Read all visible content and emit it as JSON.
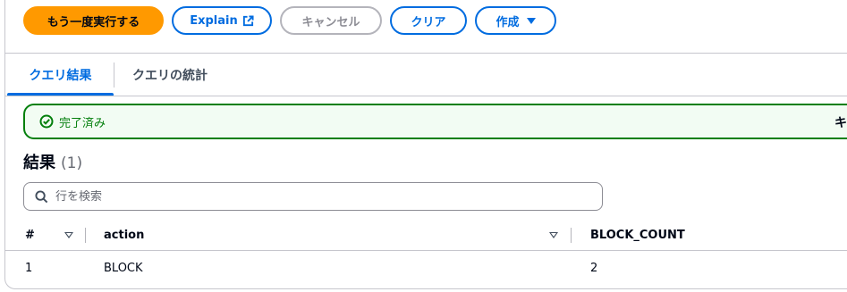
{
  "toolbar": {
    "run_again": "もう一度実行する",
    "explain": "Explain",
    "cancel": "キャンセル",
    "clear": "クリア",
    "create": "作成"
  },
  "tabs": [
    {
      "label": "クエリ結果",
      "active": true
    },
    {
      "label": "クエリの統計",
      "active": false
    }
  ],
  "status": {
    "text": "完了済み",
    "right_text": "キ",
    "color": "#037f0c"
  },
  "results": {
    "title": "結果",
    "count": "(1)"
  },
  "search": {
    "placeholder": "行を検索",
    "value": ""
  },
  "table": {
    "columns": [
      "#",
      "action",
      "BLOCK_COUNT"
    ],
    "rows": [
      [
        "1",
        "BLOCK",
        "2"
      ]
    ]
  },
  "colors": {
    "primary": "#ff9900",
    "accent": "#006ce0",
    "success": "#037f0c"
  },
  "icons": [
    "external-link-icon",
    "caret-down-icon",
    "check-circle-icon",
    "search-icon",
    "sort-icon"
  ]
}
